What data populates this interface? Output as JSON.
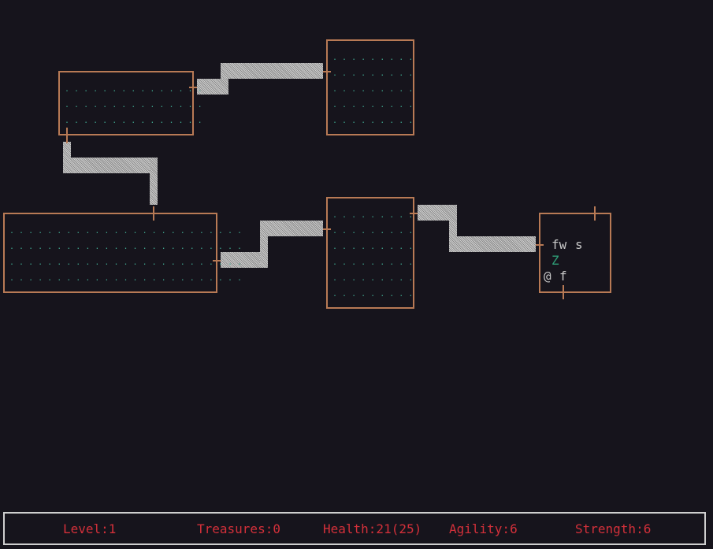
{
  "game": {
    "floor_char": ".",
    "colors": {
      "background": "#16141c",
      "wall": "#b87a55",
      "floor": "#3fa68f",
      "corridor": "#cfcfcf",
      "text": "#c8c8c8",
      "zombie": "#2f9f78",
      "status": "#d3303a",
      "status_border": "#cfcfcf"
    },
    "entities": {
      "fw": "fw",
      "s": "s",
      "z": "Z",
      "player": "@",
      "f": "f"
    }
  },
  "status": {
    "level": "Level:1",
    "treasures": "Treasures:0",
    "health": "Health:21(25)",
    "agility": "Agility:6",
    "strength": "Strength:6"
  }
}
